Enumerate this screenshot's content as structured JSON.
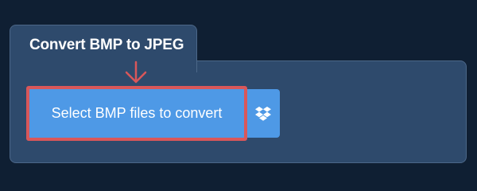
{
  "tab": {
    "title": "Convert BMP to JPEG"
  },
  "main": {
    "select_button_label": "Select BMP files to convert",
    "dropbox_icon": "dropbox-icon",
    "pointer_arrow_icon": "down-arrow-icon"
  },
  "colors": {
    "background": "#0f1f33",
    "panel": "#2e4a6c",
    "button": "#4e99e6",
    "highlight": "#d9575a",
    "text": "#ffffff"
  }
}
